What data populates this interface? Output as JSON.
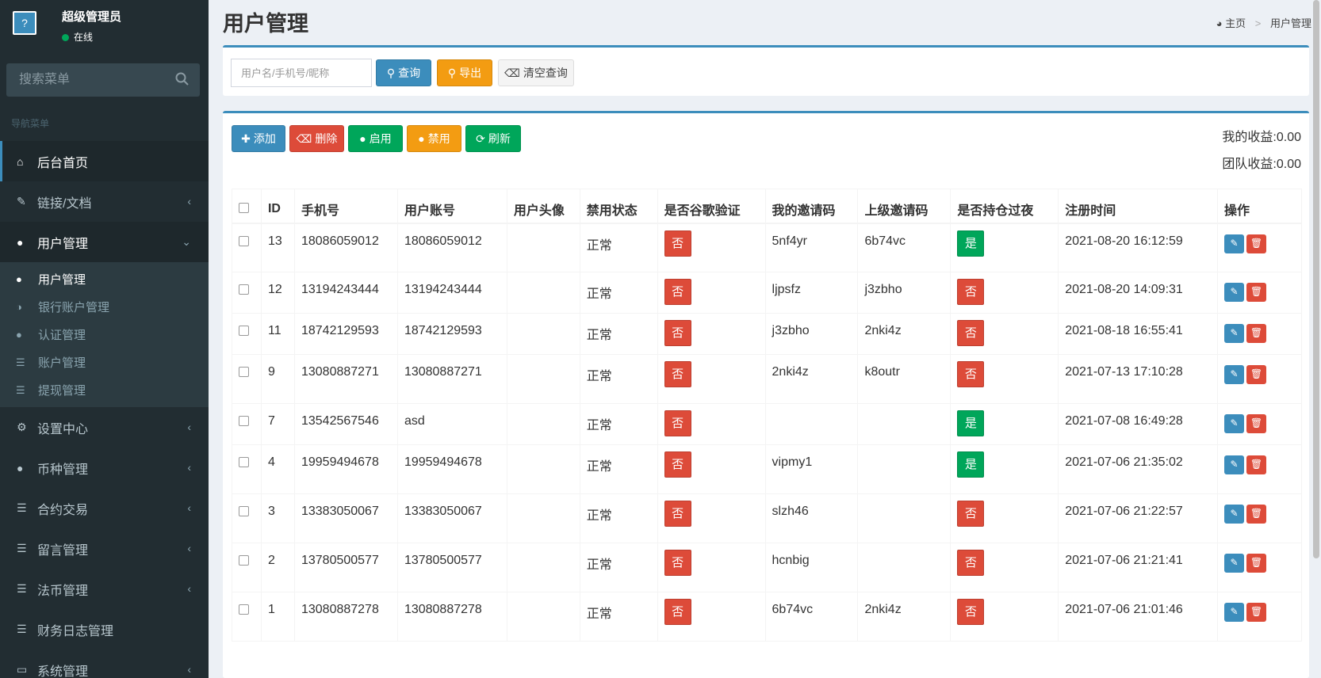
{
  "sidebar": {
    "user_name": "超级管理员",
    "user_status": "在线",
    "avatar_text": "?",
    "search_placeholder": "搜索菜单",
    "nav_header": "导航菜单",
    "items": [
      {
        "label": "后台首页",
        "icon": "home-icon"
      },
      {
        "label": "链接/文档",
        "icon": "pencil-icon"
      },
      {
        "label": "用户管理",
        "icon": "users-icon"
      },
      {
        "label": "设置中心",
        "icon": "cogs-icon"
      },
      {
        "label": "币种管理",
        "icon": "circle-icon"
      },
      {
        "label": "合约交易",
        "icon": "list-icon"
      },
      {
        "label": "留言管理",
        "icon": "list-icon"
      },
      {
        "label": "法币管理",
        "icon": "list-icon"
      },
      {
        "label": "财务日志管理",
        "icon": "list-icon"
      },
      {
        "label": "系统管理",
        "icon": "desktop-icon"
      }
    ],
    "submenu": [
      {
        "label": "用户管理",
        "icon": "user-icon"
      },
      {
        "label": "银行账户管理",
        "icon": "adjust-icon"
      },
      {
        "label": "认证管理",
        "icon": "circle-icon"
      },
      {
        "label": "账户管理",
        "icon": "list-icon"
      },
      {
        "label": "提现管理",
        "icon": "list-icon"
      }
    ]
  },
  "header": {
    "title": "用户管理",
    "breadcrumb_home": "主页",
    "breadcrumb_current": "用户管理"
  },
  "search": {
    "placeholder": "用户名/手机号/昵称",
    "query_label": "查询",
    "export_label": "导出",
    "clear_label": "清空查询"
  },
  "toolbar": {
    "add_label": "添加",
    "delete_label": "删除",
    "enable_label": "启用",
    "disable_label": "禁用",
    "refresh_label": "刷新"
  },
  "earnings": {
    "mine": "我的收益:0.00",
    "team": "团队收益:0.00"
  },
  "table": {
    "columns": [
      "ID",
      "手机号",
      "用户账号",
      "用户头像",
      "禁用状态",
      "是否谷歌验证",
      "我的邀请码",
      "上级邀请码",
      "是否持仓过夜",
      "注册时间",
      "操作"
    ],
    "rows": [
      {
        "id": "13",
        "phone": "18086059012",
        "account": "18086059012",
        "status": "正常",
        "google": "否",
        "code": "5nf4yr",
        "parent": "6b74vc",
        "overnight": "是",
        "time": "2021-08-20 16:12:59"
      },
      {
        "id": "12",
        "phone": "13194243444",
        "account": "13194243444",
        "status": "正常",
        "google": "否",
        "code": "ljpsfz",
        "parent": "j3zbho",
        "overnight": "否",
        "time": "2021-08-20 14:09:31"
      },
      {
        "id": "11",
        "phone": "18742129593",
        "account": "18742129593",
        "status": "正常",
        "google": "否",
        "code": "j3zbho",
        "parent": "2nki4z",
        "overnight": "否",
        "time": "2021-08-18 16:55:41"
      },
      {
        "id": "9",
        "phone": "13080887271",
        "account": "13080887271",
        "status": "正常",
        "google": "否",
        "code": "2nki4z",
        "parent": "k8outr",
        "overnight": "否",
        "time": "2021-07-13 17:10:28"
      },
      {
        "id": "7",
        "phone": "13542567546",
        "account": "asd",
        "status": "正常",
        "google": "否",
        "code": "",
        "parent": "",
        "overnight": "是",
        "time": "2021-07-08 16:49:28"
      },
      {
        "id": "4",
        "phone": "19959494678",
        "account": "19959494678",
        "status": "正常",
        "google": "否",
        "code": "vipmy1",
        "parent": "",
        "overnight": "是",
        "time": "2021-07-06 21:35:02"
      },
      {
        "id": "3",
        "phone": "13383050067",
        "account": "13383050067",
        "status": "正常",
        "google": "否",
        "code": "slzh46",
        "parent": "",
        "overnight": "否",
        "time": "2021-07-06 21:22:57"
      },
      {
        "id": "2",
        "phone": "13780500577",
        "account": "13780500577",
        "status": "正常",
        "google": "否",
        "code": "hcnbig",
        "parent": "",
        "overnight": "否",
        "time": "2021-07-06 21:21:41"
      },
      {
        "id": "1",
        "phone": "13080887278",
        "account": "13080887278",
        "status": "正常",
        "google": "否",
        "code": "6b74vc",
        "parent": "2nki4z",
        "overnight": "否",
        "time": "2021-07-06 21:01:46"
      }
    ]
  },
  "colors": {
    "sidebar_bg": "#222d32",
    "primary": "#3c8dbc",
    "danger": "#dd4b39",
    "success": "#00a65a",
    "warning": "#f39c12"
  }
}
